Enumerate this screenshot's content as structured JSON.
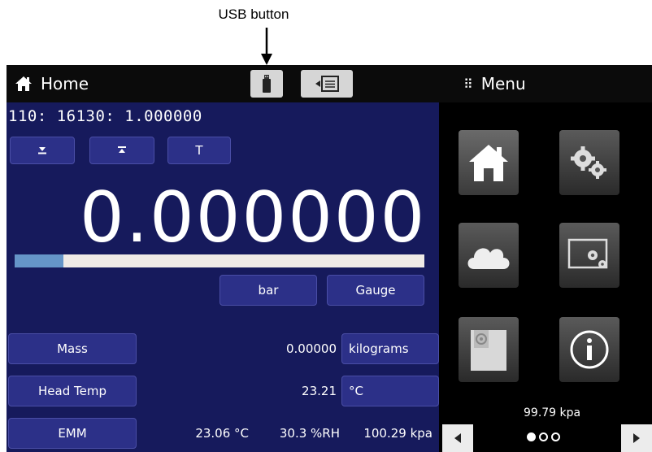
{
  "callout": {
    "label": "USB button"
  },
  "header": {
    "home_label": "Home",
    "menu_label": "Menu",
    "menu_dots": "⠿"
  },
  "main": {
    "channel": "110: 16130:  1.000000",
    "zero_button_label": "",
    "tare_button_label": "",
    "t_button_label": "T",
    "reading": "0.000000",
    "range_fraction": 0.12,
    "unit_button": "bar",
    "mode_button": "Gauge",
    "rows": [
      {
        "label": "Mass",
        "value": "0.00000",
        "unit": "kilograms"
      },
      {
        "label": "Head Temp",
        "value": "23.21",
        "unit": "°C"
      },
      {
        "label": "EMM",
        "temp": "23.06 °C",
        "humidity": "30.3 %RH",
        "pressure": "100.29 kpa"
      }
    ]
  },
  "sidebar": {
    "tiles": [
      "home-icon",
      "gears-icon",
      "cloud-icon",
      "screen-settings-icon",
      "storage-icon",
      "info-icon"
    ],
    "pressure": "99.79 kpa",
    "page_index": 0,
    "page_count": 3
  },
  "colors": {
    "main_bg": "#161a5c",
    "button_bg": "#2c3088",
    "bar_fill": "#6595c8",
    "bar_track": "#efeae6"
  }
}
